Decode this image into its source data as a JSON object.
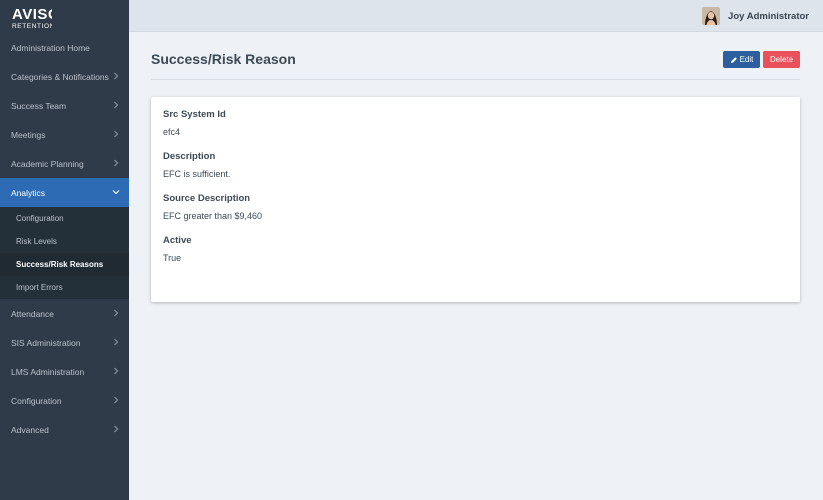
{
  "brand": {
    "logo_top": "AVISO",
    "logo_bottom": "RETENTION"
  },
  "sidebar": {
    "items": [
      {
        "label": "Administration Home",
        "has_chevron": false
      },
      {
        "label": "Categories & Notifications",
        "has_chevron": true
      },
      {
        "label": "Success Team",
        "has_chevron": true
      },
      {
        "label": "Meetings",
        "has_chevron": true
      },
      {
        "label": "Academic Planning",
        "has_chevron": true
      },
      {
        "label": "Analytics",
        "has_chevron": true,
        "active": true,
        "chevron": "chevron-down-icon"
      },
      {
        "label": "Attendance",
        "has_chevron": true
      },
      {
        "label": "SIS Administration",
        "has_chevron": true
      },
      {
        "label": "LMS Administration",
        "has_chevron": true
      },
      {
        "label": "Configuration",
        "has_chevron": true
      },
      {
        "label": "Advanced",
        "has_chevron": true
      }
    ],
    "analytics_sub": [
      {
        "label": "Configuration"
      },
      {
        "label": "Risk Levels"
      },
      {
        "label": "Success/Risk Reasons",
        "current": true
      },
      {
        "label": "Import Errors"
      }
    ]
  },
  "header": {
    "user_name": "Joy Administrator",
    "avatar_icon": "user-avatar"
  },
  "main": {
    "title": "Success/Risk Reason",
    "edit_label": "Edit",
    "delete_label": "Delete",
    "fields": [
      {
        "label": "Src System Id",
        "value": "efc4"
      },
      {
        "label": "Description",
        "value": "EFC is sufficient."
      },
      {
        "label": "Source Description",
        "value": "EFC greater than $9,460"
      },
      {
        "label": "Active",
        "value": "True"
      }
    ]
  },
  "colors": {
    "sidebar_bg": "#2f3b48",
    "active_blue": "#2d6cb5",
    "edit_blue": "#2c5f9e",
    "delete_red": "#e8505b"
  }
}
